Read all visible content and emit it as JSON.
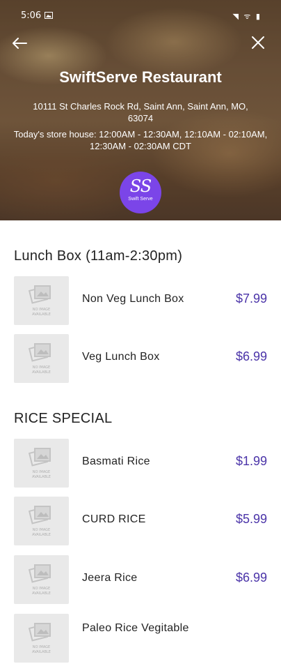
{
  "status_bar": {
    "time": "5:06",
    "icons": "◥ ᯤ ▮"
  },
  "header": {
    "restaurant_name": "SwiftServe Restaurant",
    "address": "10111 St Charles Rock Rd, Saint Ann, Saint Ann, MO, 63074",
    "hours": "Today's store house: 12:00AM - 12:30AM, 12:10AM - 02:10AM, 12:30AM - 02:30AM CDT",
    "logo_monogram": "SS",
    "logo_text": "Swift Serve"
  },
  "colors": {
    "accent": "#7b45e8",
    "price": "#4a33a8"
  },
  "placeholder": {
    "line1": "NO IMAGE",
    "line2": "AVAILABLE"
  },
  "sections": [
    {
      "title": "Lunch Box (11am-2:30pm)",
      "items": [
        {
          "name": "Non Veg Lunch Box",
          "price": "$7.99"
        },
        {
          "name": "Veg Lunch Box",
          "price": "$6.99"
        }
      ]
    },
    {
      "title": "RICE SPECIAL",
      "items": [
        {
          "name": "Basmati Rice",
          "price": "$1.99"
        },
        {
          "name": "CURD RICE",
          "price": "$5.99"
        },
        {
          "name": "Jeera Rice",
          "price": "$6.99"
        },
        {
          "name": "Paleo Rice Vegitable",
          "price": ""
        }
      ]
    }
  ]
}
